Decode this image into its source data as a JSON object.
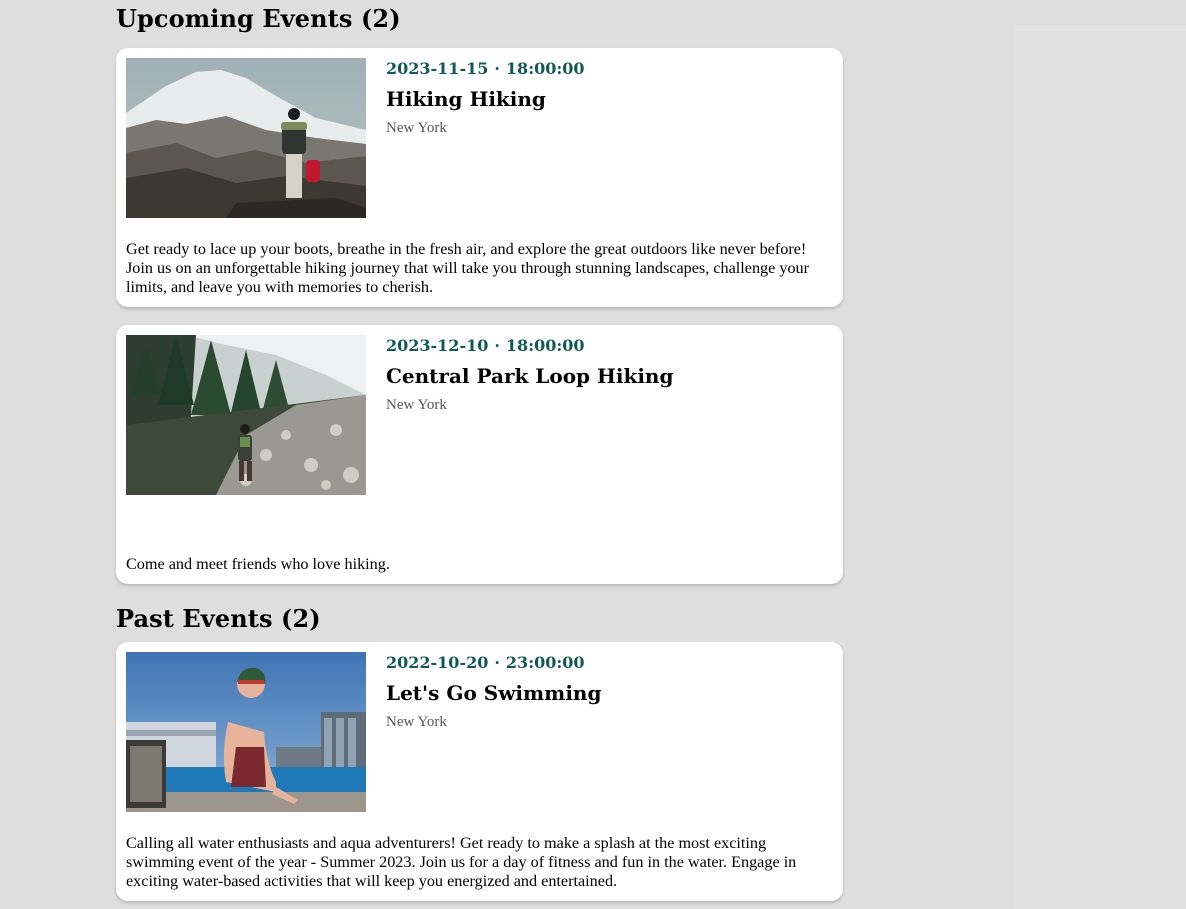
{
  "upcoming": {
    "heading": "Upcoming Events (2)",
    "events": [
      {
        "date": "2023-11-15",
        "time": "18:00:00",
        "title": "Hiking Hiking",
        "location": "New York",
        "description": "Get ready to lace up your boots, breathe in the fresh air, and explore the great outdoors like never before! Join us on an unforgettable hiking journey that will take you through stunning landscapes, challenge your limits, and leave you with memories to cherish.",
        "image": "mountain-hiker-photo"
      },
      {
        "date": "2023-12-10",
        "time": "18:00:00",
        "title": "Central Park Loop Hiking",
        "location": "New York",
        "description": "Come and meet friends who love hiking.",
        "image": "forest-trail-hiker-photo"
      }
    ]
  },
  "past": {
    "heading": "Past Events (2)",
    "events": [
      {
        "date": "2022-10-20",
        "time": "23:00:00",
        "title": "Let's Go Swimming",
        "location": "New York",
        "description": "Calling all water enthusiasts and aqua adventurers! Get ready to make a splash at the most exciting swimming event of the year - Summer 2023. Join us for a day of fitness and fun in the water. Engage in exciting water-based activities that will keep you energized and entertained.",
        "image": "swimmer-pool-photo"
      }
    ]
  },
  "colors": {
    "background": "#dedede",
    "card": "#ffffff",
    "accent": "#0f5a55",
    "location": "#555555"
  },
  "separator": "·"
}
